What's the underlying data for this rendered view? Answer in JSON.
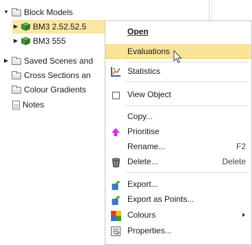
{
  "tree": {
    "items": [
      {
        "label": "Block Models",
        "expander": "▼",
        "icon": "folder-icon"
      },
      {
        "label": "BM3 2.52.52.5",
        "expander": "▶",
        "icon": "block-model-icon",
        "selected": true
      },
      {
        "label": "BM3 555",
        "expander": "▶",
        "icon": "block-model-icon"
      },
      {
        "label": "Saved Scenes and",
        "expander": "▶",
        "icon": "folder-icon"
      },
      {
        "label": "Cross Sections an",
        "expander": "",
        "icon": "folder-icon"
      },
      {
        "label": "Colour Gradients",
        "expander": "",
        "icon": "folder-icon"
      },
      {
        "label": "Notes",
        "expander": "",
        "icon": "notes-icon"
      }
    ]
  },
  "menu": {
    "items": {
      "open": {
        "label": "Open",
        "mnemonic": "O"
      },
      "evaluations": {
        "label": "Evaluations",
        "mnemonic": "u"
      },
      "statistics": {
        "label": "Statistics",
        "mnemonic": "S"
      },
      "view_object": {
        "label": "View Object",
        "mnemonic": "V"
      },
      "copy": {
        "label": "Copy...",
        "mnemonic": "C"
      },
      "prioritise": {
        "label": "Prioritise",
        "mnemonic": "r"
      },
      "rename": {
        "label": "Rename...",
        "shortcut": "F2"
      },
      "delete": {
        "label": "Delete...",
        "shortcut": "Delete"
      },
      "export": {
        "label": "Export...",
        "mnemonic": "E"
      },
      "export_points": {
        "label": "Export as Points...",
        "mnemonic": "x"
      },
      "colours": {
        "label": "Colours",
        "mnemonic": "l"
      },
      "properties": {
        "label": "Properties...",
        "mnemonic": "P"
      }
    }
  },
  "colors": {
    "selection": "#fbe6a2",
    "menu_highlight": "#fbe39a",
    "prioritise_arrow": "#d433e8",
    "cube_green": "#3f9b2a"
  }
}
